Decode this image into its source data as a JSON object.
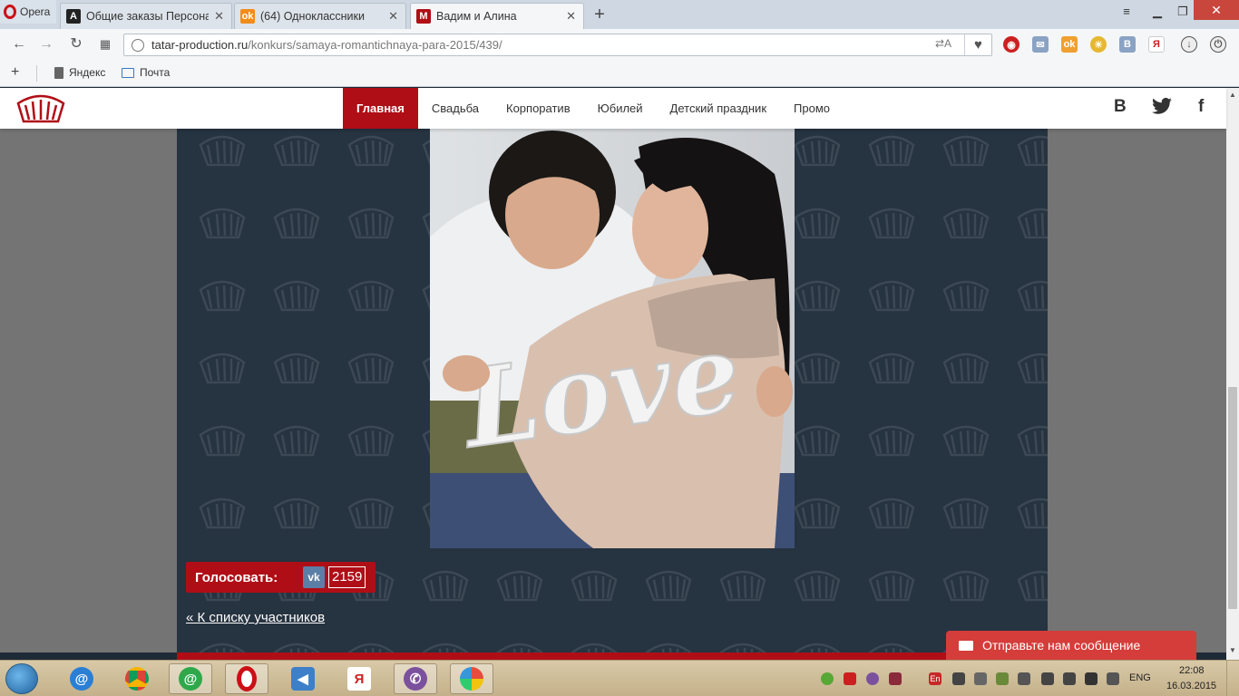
{
  "browser": {
    "menu_label": "Opera",
    "tabs": [
      {
        "title": "Общие заказы Персонал",
        "close": "✕",
        "favicon": "A",
        "favicon_color": "#222222"
      },
      {
        "title": "(64) Одноклассники",
        "close": "✕",
        "favicon": "ok",
        "favicon_color": "#f28c1a"
      },
      {
        "title": "Вадим и Алина",
        "close": "✕",
        "favicon": "M",
        "favicon_color": "#b00e16"
      }
    ],
    "new_tab": "+",
    "url_host": "tatar-production.ru",
    "url_path": "/konkurs/samaya-romantichnaya-para-2015/439/",
    "bookmarks": [
      {
        "label": "Яндекс"
      },
      {
        "label": "Почта"
      }
    ]
  },
  "site": {
    "nav": [
      {
        "label": "Главная",
        "active": true
      },
      {
        "label": "Свадьба",
        "active": false
      },
      {
        "label": "Корпоратив",
        "active": false
      },
      {
        "label": "Юбилей",
        "active": false
      },
      {
        "label": "Детский праздник",
        "active": false
      },
      {
        "label": "Промо",
        "active": false
      }
    ],
    "social": {
      "vk": "В",
      "twitter": "🐦",
      "facebook": "f"
    },
    "photo_word": "Love",
    "vote": {
      "label": "Голосовать:",
      "vk_label": "vk",
      "count": "2159"
    },
    "back_link": "« К списку участников",
    "chat_label": "Отправьте нам сообщение",
    "accent_color": "#b00e16"
  },
  "taskbar": {
    "apps": [
      "mail-ru-agent",
      "chrome",
      "icq",
      "opera",
      "volume",
      "yandex",
      "viber",
      "paint"
    ],
    "tray_lang": "ENG",
    "time": "22:08",
    "date": "16.03.2015"
  }
}
